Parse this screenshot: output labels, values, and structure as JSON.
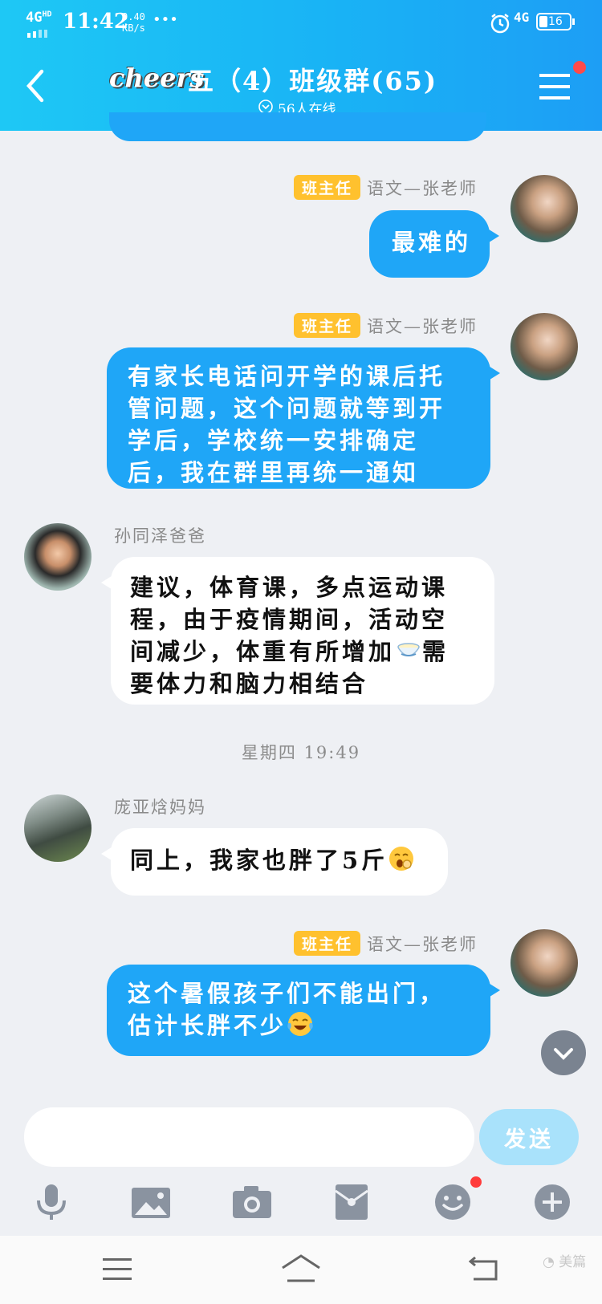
{
  "status_bar": {
    "network": "4G",
    "network_sup": "HD",
    "time": "11:42",
    "speed_value": "0.40",
    "speed_unit": "KB/s",
    "more": "•••",
    "right_network": "4G",
    "battery": "16"
  },
  "header": {
    "logo": "cheers",
    "title": "五（4）班级群(65)",
    "online": "56人在线"
  },
  "messages": [
    {
      "sender": "语文—张老师",
      "badge": "班主任",
      "text": "最难的"
    },
    {
      "sender": "语文—张老师",
      "badge": "班主任",
      "lines": [
        "有家长电话问开学的课后托",
        "管问题，这个问题就等到开",
        "学后，学校统一安排确定",
        "后，我在群里再统一通知"
      ]
    },
    {
      "sender": "孙同泽爸爸",
      "lines": [
        "建议，体育课，多点运动课",
        "程，由于疫情期间，活动空",
        "间减少，体重有所增加",
        "要体力和脑力相结合"
      ],
      "line3_tail": "需"
    },
    {
      "sender": "庞亚焓妈妈",
      "text": "同上，我家也胖了5斤"
    },
    {
      "sender": "语文—张老师",
      "badge": "班主任",
      "lines": [
        "这个暑假孩子们不能出门，",
        "估计长胖不少"
      ]
    }
  ],
  "time_divider": "星期四 19:49",
  "input": {
    "placeholder": "",
    "send_label": "发送"
  },
  "toolbar": [
    "microphone-icon",
    "image-icon",
    "camera-icon",
    "red-packet-icon",
    "emoji-icon",
    "plus-icon"
  ],
  "watermark": "美篇",
  "colors": {
    "header": "#19b3f5",
    "my_bubble": "#1fa6f7",
    "badge": "#ffc12e",
    "send_button": "#a9e2fb"
  }
}
